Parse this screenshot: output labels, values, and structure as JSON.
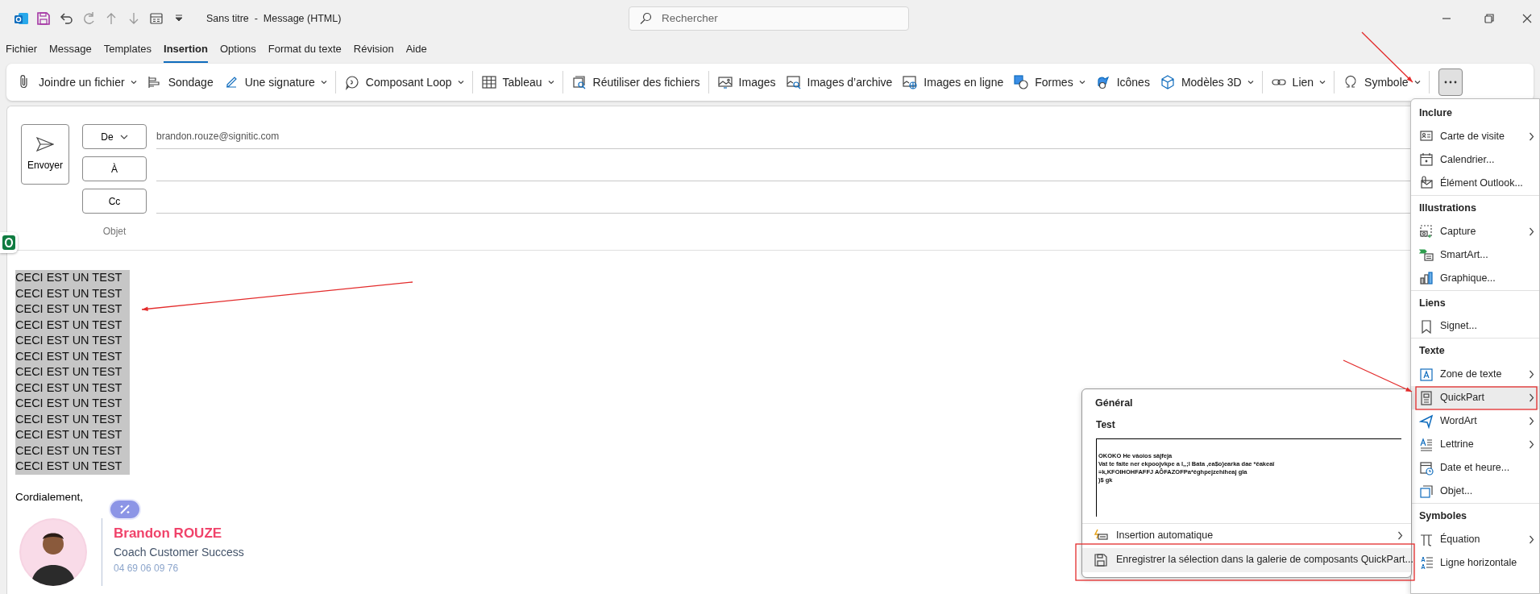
{
  "window": {
    "title": "Sans titre  -  Message (HTML)",
    "search_placeholder": "Rechercher"
  },
  "menu_tabs": [
    {
      "label": "Fichier",
      "selected": false
    },
    {
      "label": "Message",
      "selected": false
    },
    {
      "label": "Templates",
      "selected": false
    },
    {
      "label": "Insertion",
      "selected": true
    },
    {
      "label": "Options",
      "selected": false
    },
    {
      "label": "Format du texte",
      "selected": false
    },
    {
      "label": "Révision",
      "selected": false
    },
    {
      "label": "Aide",
      "selected": false
    }
  ],
  "ribbon_groups": [
    {
      "items": [
        {
          "label": "Joindre un fichier",
          "dropdown": true
        },
        {
          "label": "Sondage",
          "dropdown": false
        },
        {
          "label": "Une signature",
          "dropdown": true
        }
      ]
    },
    {
      "items": [
        {
          "label": "Composant Loop",
          "dropdown": true
        }
      ]
    },
    {
      "items": [
        {
          "label": "Tableau",
          "dropdown": true
        }
      ]
    },
    {
      "items": [
        {
          "label": "Réutiliser des fichiers",
          "dropdown": false
        }
      ]
    },
    {
      "items": [
        {
          "label": "Images",
          "dropdown": false
        },
        {
          "label": "Images d’archive",
          "dropdown": false
        },
        {
          "label": "Images en ligne",
          "dropdown": false
        },
        {
          "label": "Formes",
          "dropdown": true
        },
        {
          "label": "Icônes",
          "dropdown": false
        },
        {
          "label": "Modèles 3D",
          "dropdown": true
        }
      ]
    },
    {
      "items": [
        {
          "label": "Lien",
          "dropdown": true
        }
      ]
    },
    {
      "items": [
        {
          "label": "Symbole",
          "dropdown": true
        }
      ]
    }
  ],
  "more_button": {
    "pressed": true
  },
  "compose": {
    "send": "Envoyer",
    "from_button": "De",
    "from": "brandon.rouze@signitic.com",
    "to_button": "À",
    "cc_button": "Cc",
    "subject_label": "Objet"
  },
  "body": {
    "lines": [
      "CECI EST UN TEST",
      "CECI EST UN TEST",
      "CECI EST UN TEST",
      "CECI EST UN TEST",
      "CECI EST UN TEST",
      "CECI EST UN TEST",
      "CECI EST UN TEST",
      "CECI EST UN TEST",
      "CECI EST UN TEST",
      "CECI EST UN TEST",
      "CECI EST UN TEST",
      "CECI EST UN TEST",
      "CECI EST UN TEST"
    ],
    "selected": true,
    "closing": "Cordialement,"
  },
  "signature": {
    "name": "Brandon ROUZE",
    "title": "Coach Customer Success",
    "phone": "04 69 06 09 76"
  },
  "insert_menu": [
    {
      "title": "Inclure",
      "items": [
        {
          "label": "Carte de visite",
          "submenu": true,
          "highlighted": false
        },
        {
          "label": "Calendrier...",
          "submenu": false,
          "highlighted": false
        },
        {
          "label": "Élément Outlook...",
          "submenu": false,
          "highlighted": false
        }
      ]
    },
    {
      "title": "Illustrations",
      "items": [
        {
          "label": "Capture",
          "submenu": true,
          "highlighted": false
        },
        {
          "label": "SmartArt...",
          "submenu": false,
          "highlighted": false
        },
        {
          "label": "Graphique...",
          "submenu": false,
          "highlighted": false
        }
      ]
    },
    {
      "title": "Liens",
      "items": [
        {
          "label": "Signet...",
          "submenu": false,
          "highlighted": false
        }
      ]
    },
    {
      "title": "Texte",
      "items": [
        {
          "label": "Zone de texte",
          "submenu": true,
          "highlighted": false
        },
        {
          "label": "QuickPart",
          "submenu": true,
          "highlighted": true
        },
        {
          "label": "WordArt",
          "submenu": true,
          "highlighted": false
        },
        {
          "label": "Lettrine",
          "submenu": true,
          "highlighted": false
        },
        {
          "label": "Date et heure...",
          "submenu": false,
          "highlighted": false
        },
        {
          "label": "Objet...",
          "submenu": false,
          "highlighted": false
        }
      ]
    },
    {
      "title": "Symboles",
      "items": [
        {
          "label": "Équation",
          "submenu": true,
          "highlighted": false
        },
        {
          "label": "Ligne horizontale",
          "submenu": false,
          "highlighted": false
        }
      ]
    }
  ],
  "quickpart_menu": {
    "gallery_title": "Général",
    "entry_title": "Test",
    "preview_lines": [
      "OKOKO He vàoios sàjfeja",
      "Vat te faite ner ekpoojvkpe a l,,;l Bata ,ea$o)earka dae *êakeaî",
      "=k,KFOIHOHFAFFJ AÔFAZOFPa*êghpejzehiheaj gla",
      ")$ gk"
    ],
    "items": [
      {
        "label": "Insertion automatique",
        "submenu": true,
        "highlighted": false
      },
      {
        "label": "Enregistrer la sélection dans la galerie de composants QuickPart...",
        "submenu": false,
        "highlighted": true
      }
    ]
  }
}
